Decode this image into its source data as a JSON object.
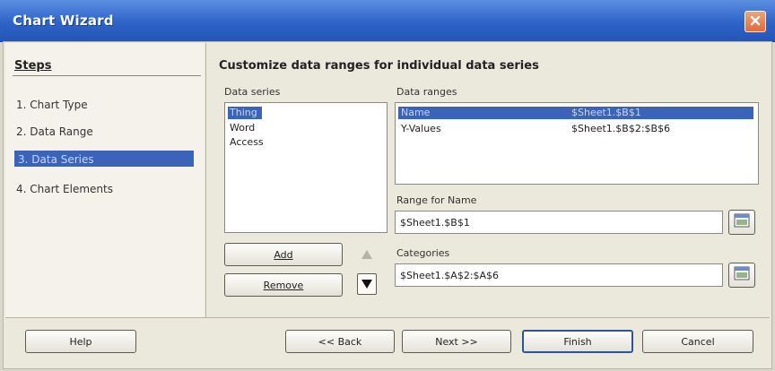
{
  "window": {
    "title": "Chart Wizard"
  },
  "steps": {
    "heading": "Steps",
    "items": [
      {
        "label": "1. Chart Type"
      },
      {
        "label": "2. Data Range"
      },
      {
        "label": "3. Data Series",
        "active": true
      },
      {
        "label": "4. Chart Elements"
      }
    ]
  },
  "main": {
    "heading": "Customize data ranges for individual data series",
    "data_series": {
      "label": "Data series",
      "items": [
        "Thing",
        "Word",
        "Access"
      ],
      "selected_index": 0
    },
    "data_ranges": {
      "label": "Data ranges",
      "rows": [
        {
          "role": "Name",
          "range": "$Sheet1.$B$1",
          "selected": true
        },
        {
          "role": "Y-Values",
          "range": "$Sheet1.$B$2:$B$6"
        }
      ]
    },
    "range_for_name": {
      "label": "Range for Name",
      "value": "$Sheet1.$B$1"
    },
    "categories": {
      "label": "Categories",
      "value": "$Sheet1.$A$2:$A$6"
    },
    "add_label": "Add",
    "remove_label": "Remove"
  },
  "footer": {
    "help": "Help",
    "back": "<< Back",
    "next": "Next >>",
    "finish": "Finish",
    "cancel": "Cancel"
  },
  "icons": {
    "close": "close-icon",
    "up": "arrow-up-icon",
    "down": "arrow-down-icon",
    "range": "range-select-icon"
  }
}
